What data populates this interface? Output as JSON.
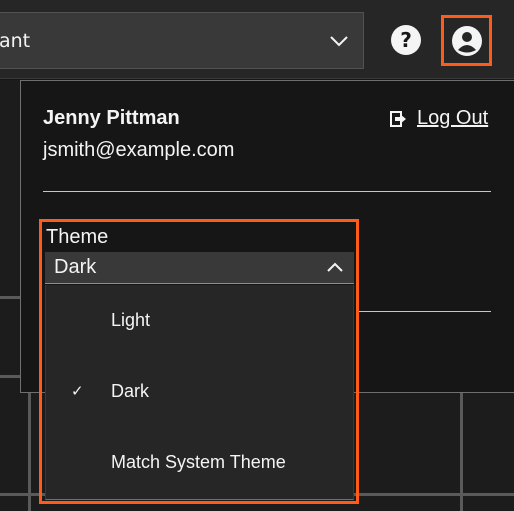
{
  "header": {
    "tenant_value_partial": "ant",
    "help_icon": "help-circle-icon",
    "user_icon": "user-avatar-icon"
  },
  "profile": {
    "name": "Jenny Pittman",
    "email": "jsmith@example.com",
    "logout_label": "Log Out",
    "logout_icon": "logout-icon"
  },
  "theme": {
    "label": "Theme",
    "selected": "Dark",
    "options": [
      {
        "label": "Light",
        "checked": false
      },
      {
        "label": "Dark",
        "checked": true
      },
      {
        "label": "Match System Theme",
        "checked": false
      }
    ],
    "check_glyph": "✓"
  },
  "colors": {
    "highlight": "#ff5b1a",
    "panel_bg": "#161616",
    "header_bg": "#262626"
  }
}
